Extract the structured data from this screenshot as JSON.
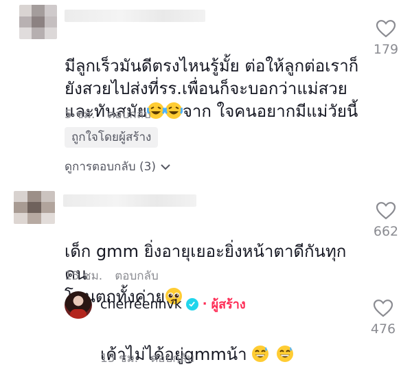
{
  "comments": [
    {
      "text": "มีลูกเร็วมันดีตรงไหนรู้มั้ย ต่อให้ลูกต่อเราก็\nยังสวยไปส่งที่รร.เพื่อนก็จะบอกว่าแม่สวย\nและทันสมัย",
      "text_after_emoji": "จาก ใจคนอยากมีแม่วัยนี้",
      "emoji": "laughing-face-emoji",
      "time": "5 ชม.",
      "reply_label": "ตอบกลับ",
      "likes": "179",
      "liked_by_creator_label": "ถูกใจโดยผู้สร้าง",
      "view_replies_label": "ดูการตอบกลับ (3)"
    },
    {
      "text": "เด็ก gmm ยิ่งอายุเยอะยิ่งหน้าตาดีกันทุกคน\nโดนตกทั้งค่าย",
      "emoji": "pleading-face-emoji",
      "time": "15 ชม.",
      "reply_label": "ตอบกลับ",
      "likes": "662"
    }
  ],
  "reply": {
    "username": "cherreenhvk",
    "separator": "·",
    "creator_label": "ผู้สร้าง",
    "text": "เค้าไม่ได้อยู่gmmน้า",
    "emoji": "grinning-sweat-emoji",
    "time": "15 ชม.",
    "reply_label": "ตอบกลับ",
    "likes": "476"
  },
  "colors": {
    "text": "#161823",
    "muted": "#8a8b91",
    "creator_accent": "#fe2c55",
    "verified": "#20d5ec",
    "badge_bg": "#f1f1f2"
  }
}
